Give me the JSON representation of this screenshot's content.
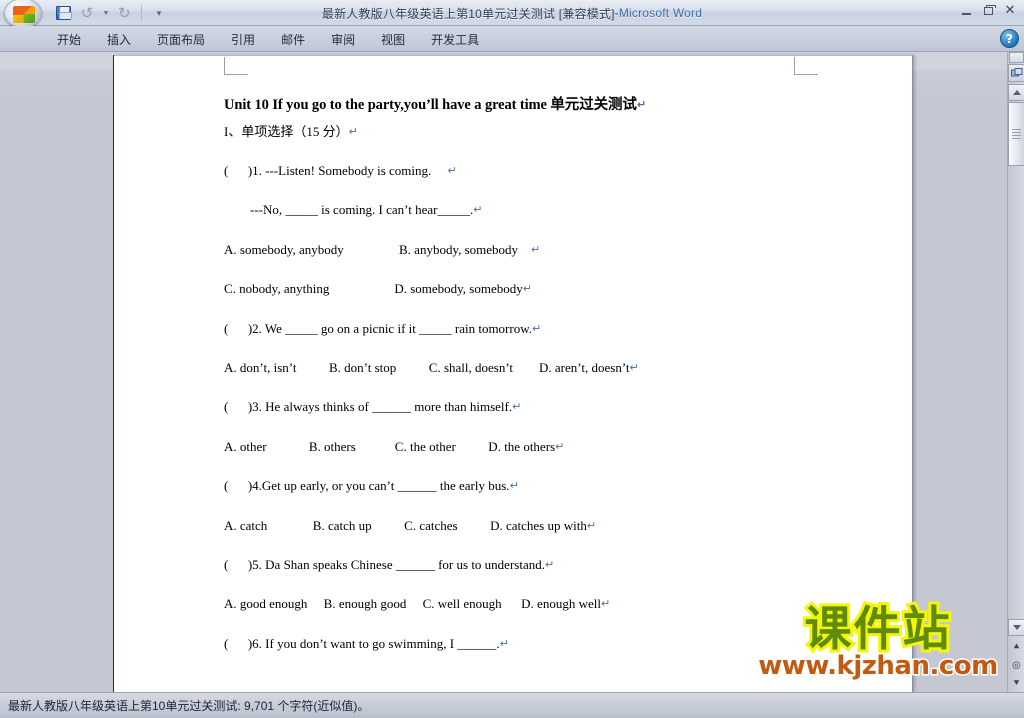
{
  "window": {
    "title_doc": "最新人教版八年级英语上第10单元过关测试 [兼容模式]",
    "title_sep": " - ",
    "title_app": "Microsoft Word",
    "minimize_label": "最小化",
    "restore_label": "向下还原",
    "close_label": "关闭"
  },
  "quick_access": {
    "office_button": "Office 按钮",
    "save": "保存",
    "undo": "撤消",
    "undo_dropdown": "撤消下拉",
    "redo": "恢复",
    "customize": "自定义快速访问工具栏"
  },
  "ribbon": {
    "tabs": [
      {
        "label": "开始"
      },
      {
        "label": "插入"
      },
      {
        "label": "页面布局"
      },
      {
        "label": "引用"
      },
      {
        "label": "邮件"
      },
      {
        "label": "审阅"
      },
      {
        "label": "视图"
      },
      {
        "label": "开发工具"
      }
    ],
    "help": "?"
  },
  "document": {
    "heading": "Unit 10 If you go to the party,you’ll have a great time 单元过关测试",
    "pilcrow": "↵",
    "paragraphs": [
      {
        "id": "section-1",
        "text": "I、单项选择（15 分）",
        "mark": "↵"
      },
      {
        "id": "q1-stem",
        "text": "(      )1. ---Listen! Somebody is coming.",
        "mark": "↵",
        "mark_gap": "     "
      },
      {
        "id": "q1-stem-2",
        "text": "        ---No, _____ is coming. I can’t hear_____.",
        "mark": "↵"
      },
      {
        "id": "q1-options-ab",
        "text": "A. somebody, anybody                 B. anybody, somebody",
        "mark": "↵",
        "mark_gap": "    "
      },
      {
        "id": "q1-options-cd",
        "text": "C. nobody, anything                    D. somebody, somebody",
        "mark": "↵"
      },
      {
        "id": "q2-stem",
        "text": "(      )2. We _____ go on a picnic if it _____ rain tomorrow.",
        "mark": "↵"
      },
      {
        "id": "q2-options",
        "text": "A. don’t, isn’t          B. don’t stop          C. shall, doesn’t        D. aren’t, doesn’t",
        "mark": "↵"
      },
      {
        "id": "q3-stem",
        "text": "(      )3. He always thinks of ______ more than himself.",
        "mark": "↵"
      },
      {
        "id": "q3-options",
        "text": "A. other             B. others            C. the other          D. the others",
        "mark": "↵"
      },
      {
        "id": "q4-stem",
        "text": "(      )4.Get up early, or you can’t ______ the early bus.",
        "mark": "↵"
      },
      {
        "id": "q4-options",
        "text": "A. catch              B. catch up          C. catches          D. catches up with",
        "mark": "↵"
      },
      {
        "id": "q5-stem",
        "text": "(      )5. Da Shan speaks Chinese ______ for us to understand.",
        "mark": "↵"
      },
      {
        "id": "q5-options",
        "text": "A. good enough     B. enough good     C. well enough      D. enough well",
        "mark": "↵"
      },
      {
        "id": "q6-stem",
        "text": "(      )6. If you don’t want to go swimming, I ______.",
        "mark": "↵"
      }
    ]
  },
  "watermark": {
    "brand_cn": "课件站",
    "brand_url": "www.kjzhan.com",
    "brand_color": "#5f8c0b",
    "brand_outline": "#f5f50a",
    "url_color": "#c35a12"
  },
  "scrollbar": {
    "split_handle": "拆分条",
    "select_browse_object": "选择浏览对象",
    "scroll_up": "向上滚动",
    "scroll_down": "向下滚动",
    "thumb": "滚动块",
    "previous_page": "上一页",
    "browse_object": "浏览对象",
    "next_page": "下一页",
    "prev_glyph": "⯅",
    "obj_glyph": "◎",
    "next_glyph": "⯆"
  },
  "statusbar": {
    "text": "最新人教版八年级英语上第10单元过关测试: 9,701 个字符(近似值)。"
  }
}
